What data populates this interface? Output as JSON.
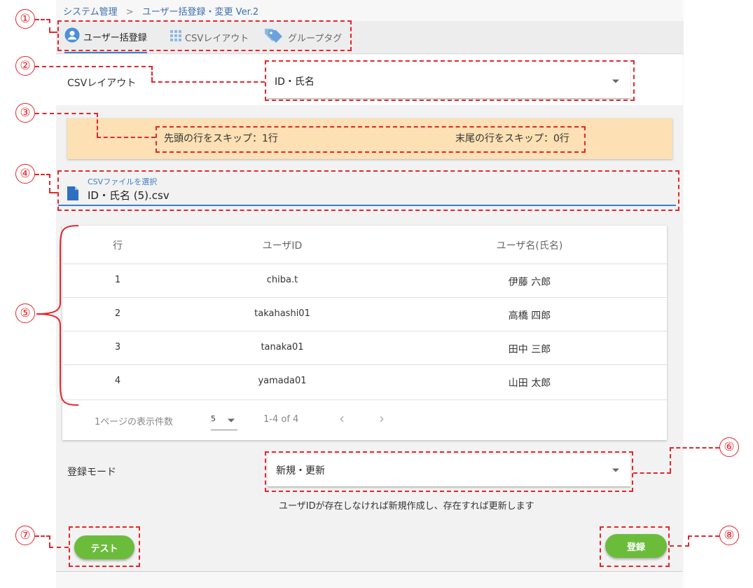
{
  "breadcrumb": {
    "root": "システム管理",
    "sep": ">",
    "current": "ユーザー括登録・変更 Ver.2"
  },
  "tabs": [
    {
      "label": "ユーザー括登録",
      "icon": "user-circle-icon",
      "active": true
    },
    {
      "label": "CSVレイアウト",
      "icon": "grid-icon",
      "active": false
    },
    {
      "label": "グループタグ",
      "icon": "tag-icon",
      "active": false
    }
  ],
  "csv_layout": {
    "label": "CSVレイアウト",
    "value": "ID・氏名"
  },
  "notice": {
    "skip_head": "先頭の行をスキップ：1行",
    "skip_tail": "末尾の行をスキップ：0行"
  },
  "file": {
    "label": "CSVファイルを選択",
    "value": "ID・氏名 (5).csv"
  },
  "table": {
    "headers": [
      "行",
      "ユーザID",
      "ユーザ名(氏名)"
    ],
    "rows": [
      [
        "1",
        "chiba.t",
        "伊藤 六郎"
      ],
      [
        "2",
        "takahashi01",
        "高橋 四郎"
      ],
      [
        "3",
        "tanaka01",
        "田中 三郎"
      ],
      [
        "4",
        "yamada01",
        "山田 太郎"
      ]
    ],
    "pager": {
      "rows_label": "1ページの表示件数",
      "rows_value": "5",
      "range": "1-4 of 4",
      "prev": "‹",
      "next": "›"
    }
  },
  "mode": {
    "label": "登録モード",
    "value": "新規・更新",
    "hint": "ユーザIDが存在しなければ新規作成し、存在すれば更新します"
  },
  "buttons": {
    "test": "テスト",
    "register": "登録"
  },
  "callouts": [
    "①",
    "②",
    "③",
    "④",
    "⑤",
    "⑥",
    "⑦",
    "⑧"
  ],
  "colors": {
    "accent": "#6cbc3c",
    "callout": "#e3262c",
    "notice_bg": "#fde0b3",
    "link": "#3d6fae"
  }
}
